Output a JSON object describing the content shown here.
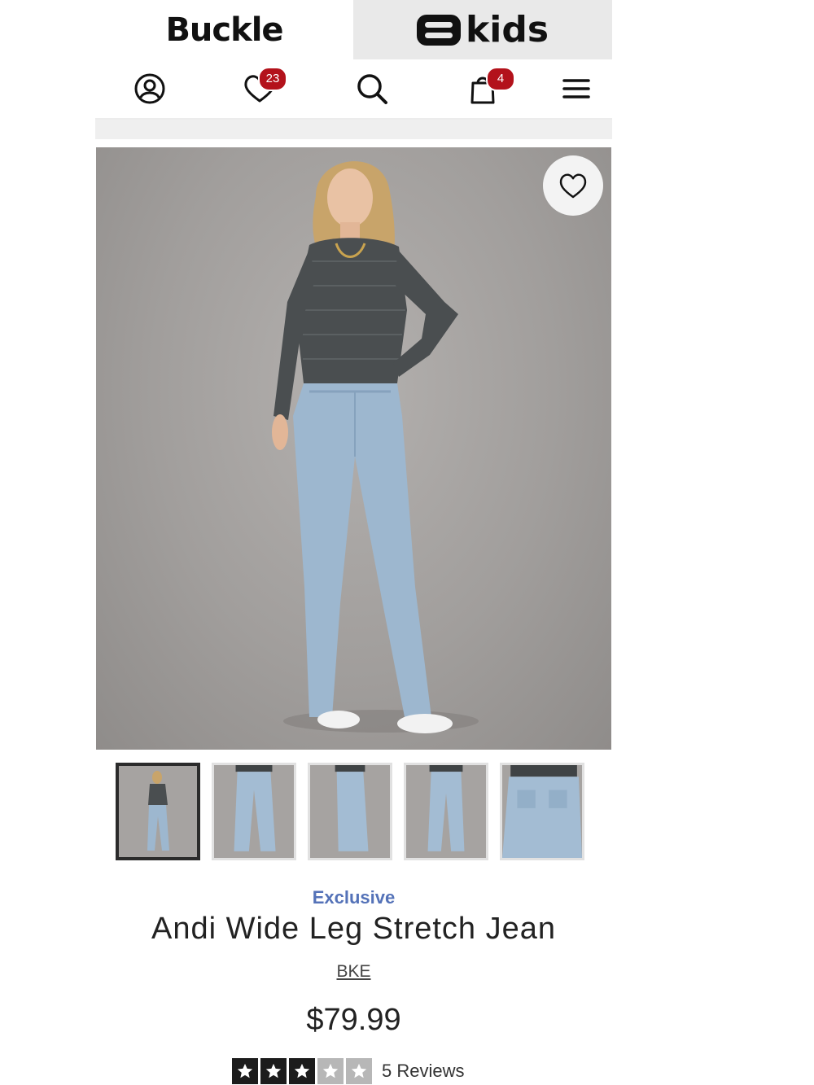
{
  "header": {
    "brand_logo": "Buckle",
    "kids_logo_text": "kids",
    "icons": [
      "account-icon",
      "heart-icon",
      "search-icon",
      "bag-icon",
      "menu-icon"
    ],
    "wishlist_count": "23",
    "cart_count": "4"
  },
  "product": {
    "tag": "Exclusive",
    "title": "Andi Wide Leg Stretch Jean",
    "brand": "BKE",
    "price": "$79.99",
    "rating": 3,
    "rating_max": 5,
    "reviews_label": "5 Reviews"
  },
  "gallery": {
    "thumbnail_count": 5,
    "active_index": 0
  },
  "colors": {
    "badge": "#b3121b",
    "exclusive": "#5472b8",
    "kids_panel": "#e9e9e9"
  }
}
